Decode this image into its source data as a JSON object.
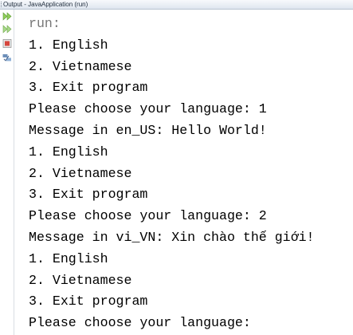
{
  "window": {
    "title": "Output - JavaApplication (run)"
  },
  "gutter": {
    "buttons": [
      {
        "icon": "rerun-icon",
        "color": "#8fce5a"
      },
      {
        "icon": "rerun-with-options-icon",
        "color": "#8fce5a"
      },
      {
        "icon": "stop-icon",
        "color": "#d6473e"
      },
      {
        "icon": "settings-icon",
        "color": "#5d7ea8"
      }
    ]
  },
  "console": {
    "lines": [
      "run:",
      "1. English",
      "2. Vietnamese",
      "3. Exit program",
      "Please choose your language: 1",
      "Message in en_US: Hello World!",
      "1. English",
      "2. Vietnamese",
      "3. Exit program",
      "Please choose your language: 2",
      "Message in vi_VN: Xin chào thế giới!",
      "1. English",
      "2. Vietnamese",
      "3. Exit program",
      "Please choose your language:"
    ]
  }
}
